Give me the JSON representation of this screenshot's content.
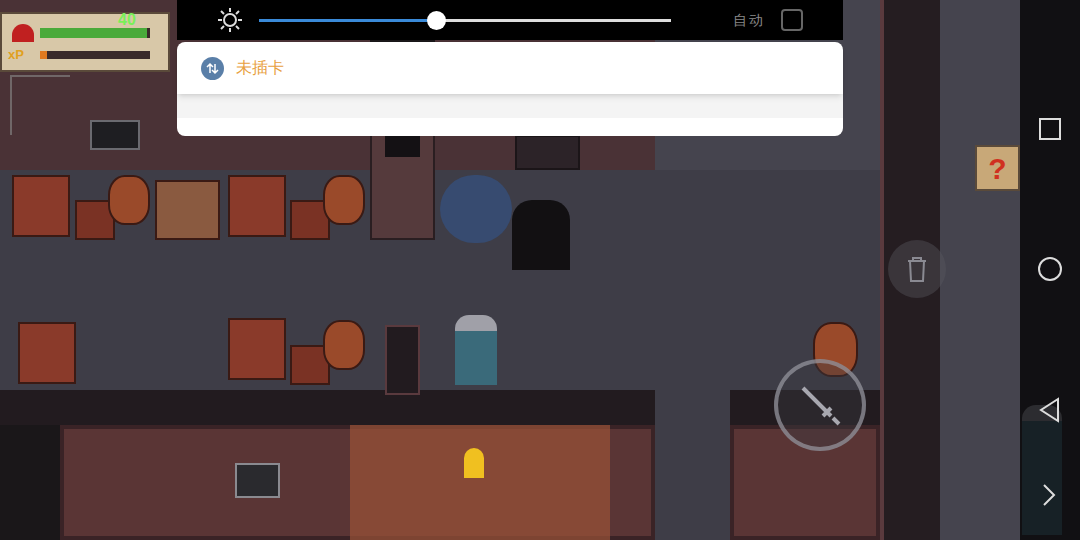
{
  "hud": {
    "hp": "40",
    "hp_level": 0.97,
    "xp_label": "xP",
    "xp_level": 0.06
  },
  "quick_settings": {
    "brightness": {
      "level": 0.43
    },
    "auto": {
      "label": "自动",
      "checked": false
    }
  },
  "notification": {
    "text": "未插卡"
  },
  "help_button": {
    "label": "?"
  }
}
